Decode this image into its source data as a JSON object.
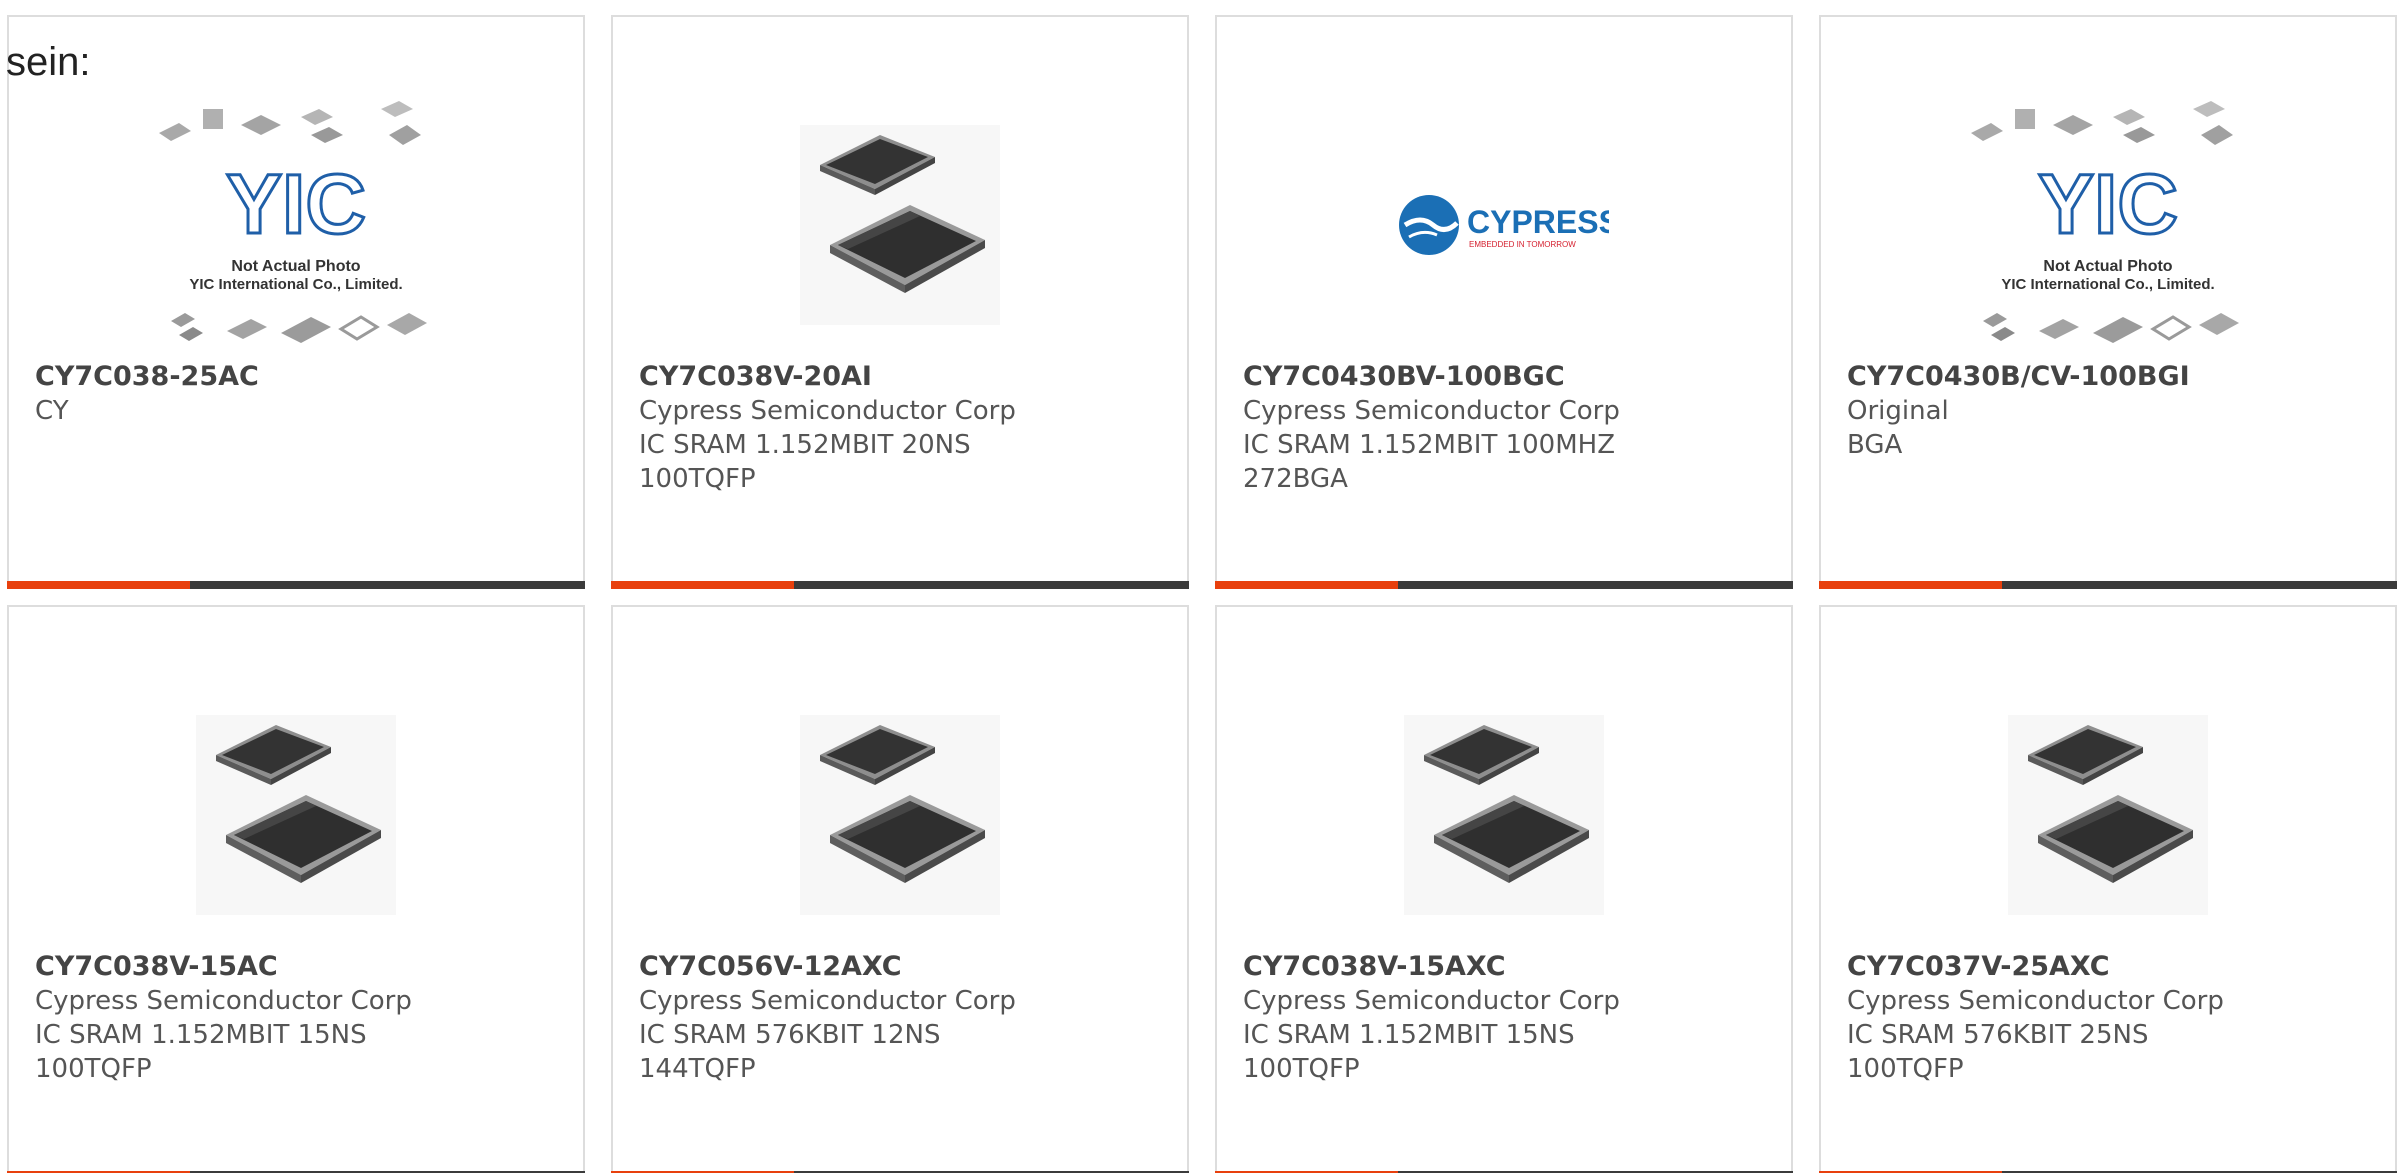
{
  "intro_text": "sein:",
  "cards": [
    {
      "part_number": "CY7C038-25AC",
      "lines": [
        "CY"
      ],
      "image": {
        "type": "placeholder-logo",
        "logo_text": "YIC",
        "caption1": "Not Actual Photo",
        "caption2": "YIC International Co., Limited."
      }
    },
    {
      "part_number": "CY7C038V-20AI",
      "lines": [
        "Cypress Semiconductor Corp",
        "IC SRAM 1.152MBIT 20NS",
        "100TQFP"
      ],
      "image": {
        "type": "chip-photo"
      }
    },
    {
      "part_number": "CY7C0430BV-100BGC",
      "lines": [
        "Cypress Semiconductor Corp",
        "IC SRAM 1.152MBIT 100MHZ",
        "272BGA"
      ],
      "image": {
        "type": "brand-logo",
        "brand": "CYPRESS",
        "tagline": "EMBEDDED IN TOMORROW"
      }
    },
    {
      "part_number": "CY7C0430B/CV-100BGI",
      "lines": [
        "Original",
        "BGA"
      ],
      "image": {
        "type": "placeholder-logo",
        "logo_text": "YIC",
        "caption1": "Not Actual Photo",
        "caption2": "YIC International Co., Limited."
      }
    },
    {
      "part_number": "CY7C038V-15AC",
      "lines": [
        "Cypress Semiconductor Corp",
        "IC SRAM 1.152MBIT 15NS",
        "100TQFP"
      ],
      "image": {
        "type": "chip-photo"
      }
    },
    {
      "part_number": "CY7C056V-12AXC",
      "lines": [
        "Cypress Semiconductor Corp",
        "IC SRAM 576KBIT 12NS 144TQFP"
      ],
      "image": {
        "type": "chip-photo"
      }
    },
    {
      "part_number": "CY7C038V-15AXC",
      "lines": [
        "Cypress Semiconductor Corp",
        "IC SRAM 1.152MBIT 15NS",
        "100TQFP"
      ],
      "image": {
        "type": "chip-photo"
      }
    },
    {
      "part_number": "CY7C037V-25AXC",
      "lines": [
        "Cypress Semiconductor Corp",
        "IC SRAM 576KBIT 25NS 100TQFP"
      ],
      "image": {
        "type": "chip-photo"
      }
    }
  ],
  "colors": {
    "accent": "#e8400d",
    "bar": "#3b3b3b",
    "chip": "#2f2f2f",
    "yic_blue": "#1f5fa8",
    "cypress_blue": "#1b6fb5",
    "cypress_red": "#d5202f"
  }
}
